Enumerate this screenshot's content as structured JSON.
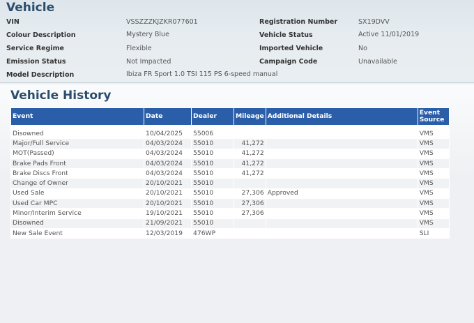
{
  "vehicle": {
    "title": "Vehicle",
    "vin_label": "VIN",
    "vin": "VSSZZZKJZKR077601",
    "colour_label": "Colour Description",
    "colour": "Mystery Blue",
    "service_regime_label": "Service Regime",
    "service_regime": "Flexible",
    "emission_label": "Emission Status",
    "emission": "Not Impacted",
    "model_label": "Model Description",
    "model": "Ibiza FR Sport 1.0 TSI 115 PS 6-speed manual",
    "registration_label": "Registration Number",
    "registration": "SX19DVV",
    "status_label": "Vehicle Status",
    "status": "Active 11/01/2019",
    "imported_label": "Imported Vehicle",
    "imported": "No",
    "campaign_label": "Campaign Code",
    "campaign": "Unavailable"
  },
  "history": {
    "title": "Vehicle History",
    "columns": [
      "Event",
      "Date",
      "Dealer",
      "Mileage",
      "Additional Details",
      "Event Source"
    ],
    "rows": [
      {
        "event": "Disowned",
        "date": "10/04/2025",
        "dealer": "55006",
        "mileage": "",
        "details": "",
        "source": "VMS"
      },
      {
        "event": "Major/Full Service",
        "date": "04/03/2024",
        "dealer": "55010",
        "mileage": "41,272",
        "details": "",
        "source": "VMS"
      },
      {
        "event": "MOT(Passed)",
        "date": "04/03/2024",
        "dealer": "55010",
        "mileage": "41,272",
        "details": "",
        "source": "VMS"
      },
      {
        "event": "Brake Pads Front",
        "date": "04/03/2024",
        "dealer": "55010",
        "mileage": "41,272",
        "details": "",
        "source": "VMS"
      },
      {
        "event": "Brake Discs Front",
        "date": "04/03/2024",
        "dealer": "55010",
        "mileage": "41,272",
        "details": "",
        "source": "VMS"
      },
      {
        "event": "Change of Owner",
        "date": "20/10/2021",
        "dealer": "55010",
        "mileage": "",
        "details": "",
        "source": "VMS"
      },
      {
        "event": "Used Sale",
        "date": "20/10/2021",
        "dealer": "55010",
        "mileage": "27,306",
        "details": "Approved",
        "source": "VMS"
      },
      {
        "event": "Used Car MPC",
        "date": "20/10/2021",
        "dealer": "55010",
        "mileage": "27,306",
        "details": "",
        "source": "VMS"
      },
      {
        "event": "Minor/Interim Service",
        "date": "19/10/2021",
        "dealer": "55010",
        "mileage": "27,306",
        "details": "",
        "source": "VMS"
      },
      {
        "event": "Disowned",
        "date": "21/09/2021",
        "dealer": "55010",
        "mileage": "",
        "details": "",
        "source": "VMS"
      },
      {
        "event": "New Sale Event",
        "date": "12/03/2019",
        "dealer": "476WP",
        "mileage": "",
        "details": "",
        "source": "SLI"
      }
    ]
  }
}
